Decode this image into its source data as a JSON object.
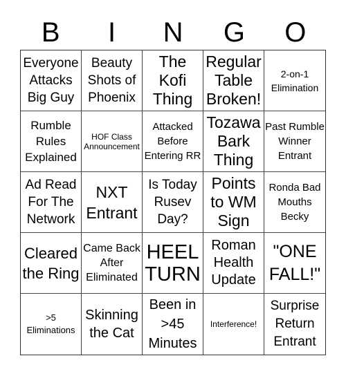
{
  "header": {
    "letters": [
      "B",
      "I",
      "N",
      "G",
      "O"
    ]
  },
  "cells": [
    [
      "Everyone Attacks Big Guy",
      "Beauty Shots of Phoenix",
      "The Kofi Thing",
      "Regular Table Broken!",
      "2-on-1 Elimination"
    ],
    [
      "Rumble Rules Explained",
      "HOF Class Announcement",
      "Attacked Before Entering RR",
      "Tozawa Bark Thing",
      "Past Rumble Winner Entrant"
    ],
    [
      "Ad Read For The Network",
      "NXT Entrant",
      "Is Today Rusev Day?",
      "Points to WM Sign",
      "Ronda Bad Mouths Becky"
    ],
    [
      "Cleared the Ring",
      "Came Back After Eliminated",
      "HEEL TURN",
      "Roman Health Update",
      "\"ONE FALL!\""
    ],
    [
      ">5 Eliminations",
      "Skinning the Cat",
      "Been in >45 Minutes",
      "Interference!",
      "Surprise Return Entrant"
    ]
  ]
}
